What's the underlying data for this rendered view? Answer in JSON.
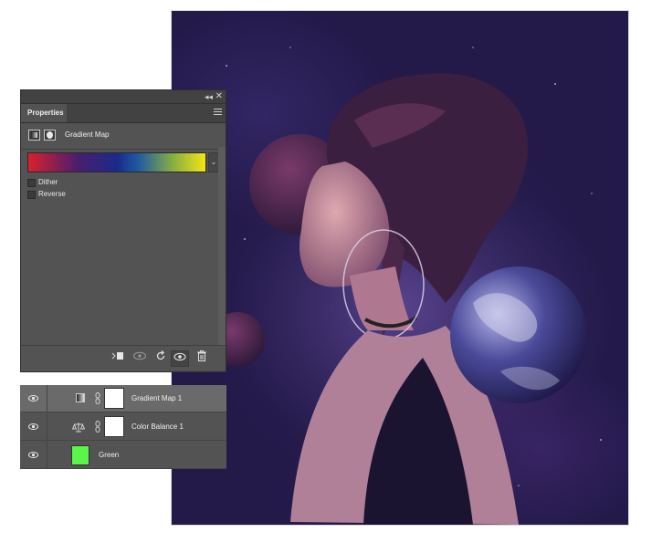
{
  "properties_panel": {
    "tab_label": "Properties",
    "title": "Gradient Map",
    "gradient_colors": [
      "#d8202e",
      "#4a1e6e",
      "#1a2a8a",
      "#1f5aa0",
      "#8ab040",
      "#f2e414"
    ],
    "options": [
      {
        "label": "Dither",
        "checked": false
      },
      {
        "label": "Reverse",
        "checked": false
      }
    ]
  },
  "layers": [
    {
      "name": "Gradient Map 1",
      "selected": true,
      "visible": true
    },
    {
      "name": "Color Balance 1",
      "selected": false,
      "visible": true
    },
    {
      "name": "Green",
      "selected": false,
      "visible": true,
      "fill_color": "#5af54a"
    }
  ],
  "colors": {
    "panel": "#535353",
    "panel_dark": "#424242",
    "canvas_bg": "#231a4a"
  }
}
